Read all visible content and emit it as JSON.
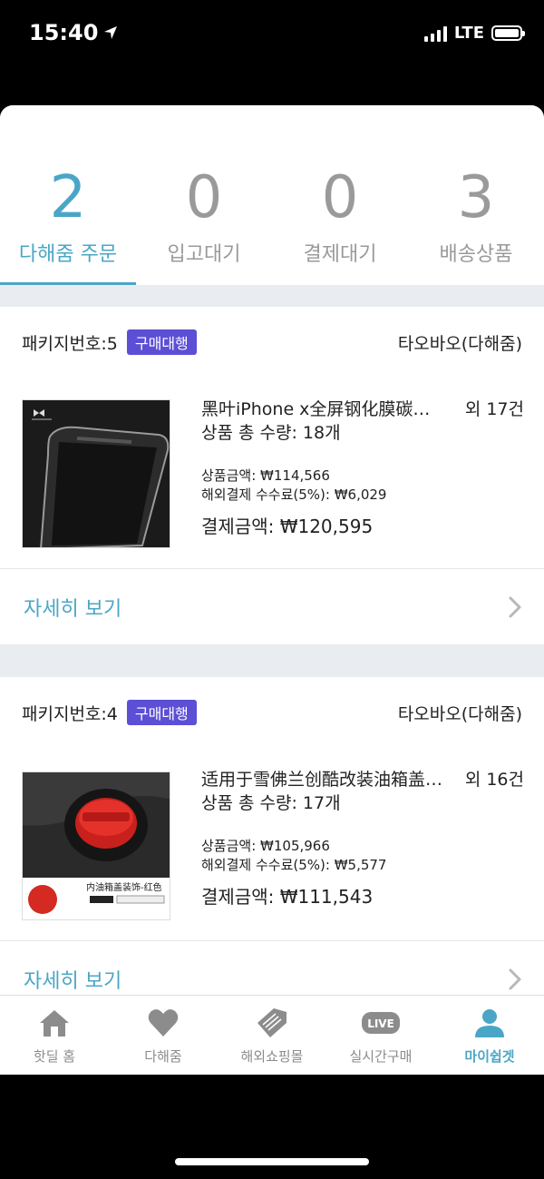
{
  "status_bar": {
    "time": "15:40",
    "network": "LTE"
  },
  "order_tabs": [
    {
      "count": "2",
      "label": "다해줌 주문",
      "active": true
    },
    {
      "count": "0",
      "label": "입고대기",
      "active": false
    },
    {
      "count": "0",
      "label": "결제대기",
      "active": false
    },
    {
      "count": "3",
      "label": "배송상품",
      "active": false
    }
  ],
  "orders": [
    {
      "package_label": "패키지번호:5",
      "badge": "구매대행",
      "shop": "타오바오(다해줌)",
      "title": "黑叶iPhone x全屏钢化膜碳…",
      "extra": "외 17건",
      "quantity": "상품 총 수량: 18개",
      "product_amount": "상품금액: ₩114,566",
      "overseas_fee": "해외결제 수수료(5%): ₩6,029",
      "payment_total": "결제금액: ₩120,595",
      "detail_link": "자세히 보기",
      "thumb_icon": "screen-protector-image"
    },
    {
      "package_label": "패키지번호:4",
      "badge": "구매대행",
      "shop": "타오바오(다해줌)",
      "title": "适用于雪佛兰创酷改装油箱盖…",
      "extra": "외 16건",
      "quantity": "상품 총 수량: 17개",
      "product_amount": "상품금액: ₩105,966",
      "overseas_fee": "해외결제 수수료(5%): ₩5,577",
      "payment_total": "결제금액: ₩111,543",
      "detail_link": "자세히 보기",
      "thumb_caption": "内油箱盖装饰-红色",
      "thumb_icon": "fuel-cap-image"
    }
  ],
  "tab_bar": [
    {
      "label": "핫딜 홈",
      "icon": "home-icon",
      "active": false
    },
    {
      "label": "다해줌",
      "icon": "heart-icon",
      "active": false
    },
    {
      "label": "해외쇼핑몰",
      "icon": "tag-icon",
      "active": false
    },
    {
      "label": "실시간구매",
      "icon": "live-icon",
      "icon_text": "LIVE",
      "active": false
    },
    {
      "label": "마이쉽겟",
      "icon": "person-icon",
      "active": true
    }
  ],
  "colors": {
    "accent": "#4aa6c6",
    "badge": "#5b4fd6",
    "inactive": "#9a9a9a",
    "background": "#e9ecf0"
  }
}
